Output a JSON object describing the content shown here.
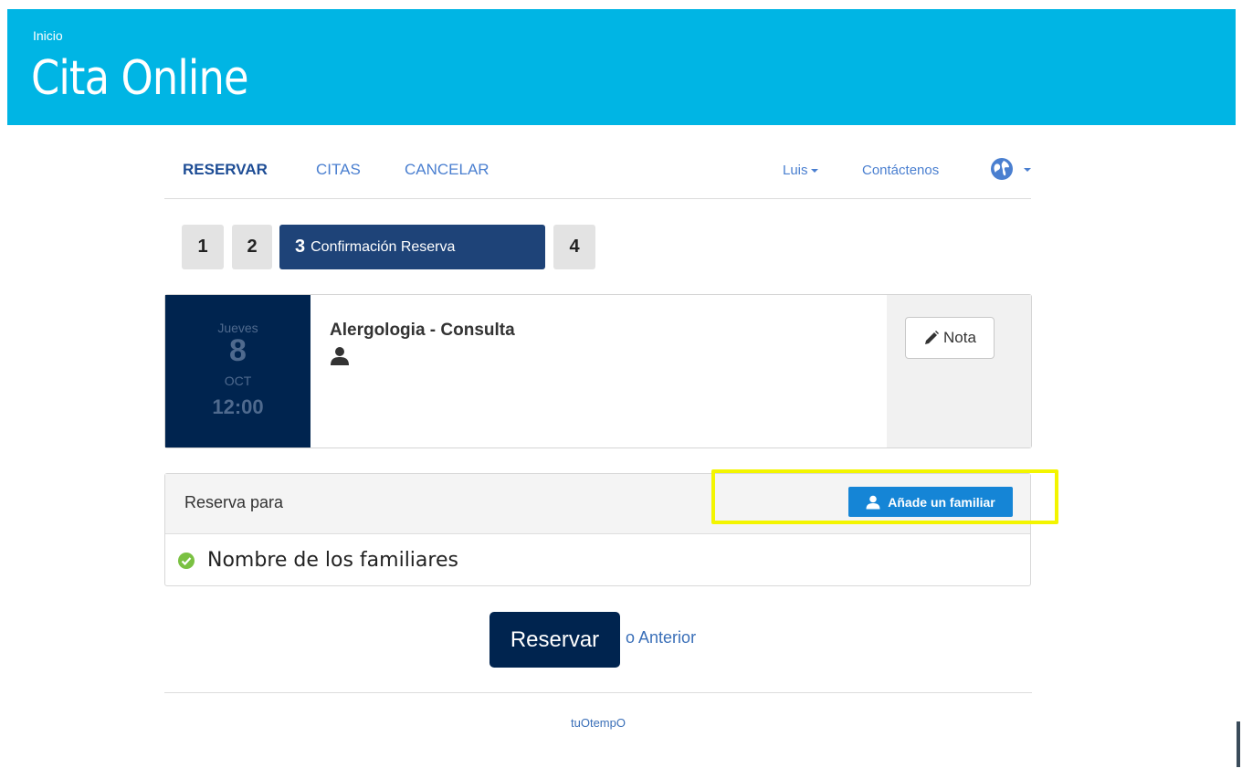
{
  "header": {
    "breadcrumb": "Inicio",
    "title": "Cita Online"
  },
  "nav": {
    "items": [
      {
        "label": "RESERVAR",
        "active": true
      },
      {
        "label": "CITAS",
        "active": false
      },
      {
        "label": "CANCELAR",
        "active": false
      }
    ],
    "user": "Luis",
    "contact": "Contáctenos",
    "language_icon": "globe-icon"
  },
  "steps": [
    {
      "number": "1",
      "label": ""
    },
    {
      "number": "2",
      "label": ""
    },
    {
      "number": "3",
      "label": "Confirmación Reserva",
      "active": true
    },
    {
      "number": "4",
      "label": ""
    }
  ],
  "appointment": {
    "day_of_week": "Jueves",
    "day": "8",
    "month": "OCT",
    "time": "12:00",
    "service": "Alergologia - Consulta",
    "note_label": "Nota"
  },
  "booking_for": {
    "header": "Reserva para",
    "add_family_label": "Añade un familiar",
    "family_names": "Nombre de los familiares"
  },
  "actions": {
    "reserve_label": "Reservar",
    "or_text": "o",
    "previous_label": "Anterior"
  },
  "footer": {
    "brand": "tuOtempO"
  },
  "colors": {
    "banner": "#00b5e4",
    "primary_dark": "#00244f",
    "step_active": "#1e4378",
    "add_button": "#1585d6",
    "highlight": "#f3f500",
    "check": "#7ac142"
  }
}
